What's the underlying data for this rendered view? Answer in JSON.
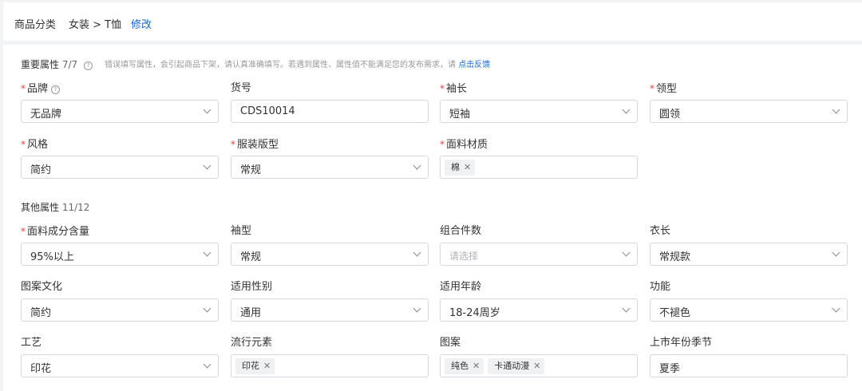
{
  "category": {
    "label": "商品分类",
    "path": "女装 > T恤",
    "edit": "修改"
  },
  "important": {
    "title": "重要属性",
    "count": "7/7",
    "notice": "错误填写属性，会引起商品下架，请认真准确填写。若遇到属性、属性值不能满足您的发布需求，请",
    "feedback": "点击反馈"
  },
  "fields": {
    "brand": {
      "label": "品牌",
      "value": "无品牌"
    },
    "item_no": {
      "label": "货号",
      "value": "CDS10014"
    },
    "sleeve_length": {
      "label": "袖长",
      "value": "短袖"
    },
    "collar": {
      "label": "领型",
      "value": "圆领"
    },
    "style": {
      "label": "风格",
      "value": "简约"
    },
    "fit": {
      "label": "服装版型",
      "value": "常规"
    },
    "material": {
      "label": "面料材质",
      "tags": [
        "棉"
      ]
    },
    "fabric_content": {
      "label": "面料成分含量",
      "value": "95%以上"
    },
    "sleeve_type": {
      "label": "袖型",
      "value": "常规"
    },
    "set_count": {
      "label": "组合件数",
      "placeholder": "请选择"
    },
    "length": {
      "label": "衣长",
      "value": "常规款"
    },
    "pattern_culture": {
      "label": "图案文化",
      "value": "简约"
    },
    "gender": {
      "label": "适用性别",
      "value": "通用"
    },
    "age": {
      "label": "适用年龄",
      "value": "18-24周岁"
    },
    "function": {
      "label": "功能",
      "value": "不褪色"
    },
    "craft": {
      "label": "工艺",
      "value": "印花"
    },
    "trend": {
      "label": "流行元素",
      "tags": [
        "印花"
      ]
    },
    "pattern": {
      "label": "图案",
      "tags": [
        "纯色",
        "卡通动漫"
      ]
    },
    "season": {
      "label": "上市年份季节",
      "value": "夏季"
    }
  },
  "other": {
    "title": "其他属性",
    "count": "11/12"
  },
  "icons": {
    "help": "question-circle-icon",
    "dropdown": "chevron-down-icon",
    "remove": "close-icon"
  },
  "colors": {
    "accent": "#1a66d9",
    "required": "#f04142",
    "border": "#d5d8de",
    "background": "#f2f3f5"
  }
}
